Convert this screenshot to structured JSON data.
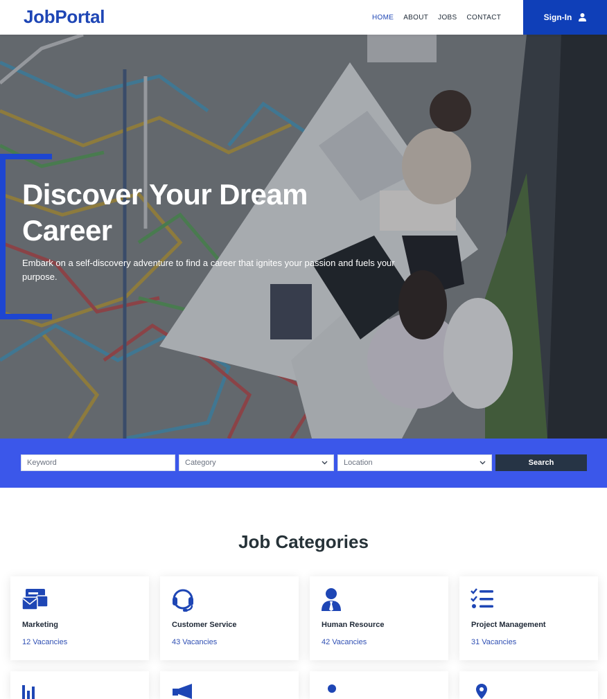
{
  "header": {
    "brand": "JobPortal",
    "nav": [
      {
        "label": "HOME",
        "active": true
      },
      {
        "label": "ABOUT",
        "active": false
      },
      {
        "label": "JOBS",
        "active": false
      },
      {
        "label": "CONTACT",
        "active": false
      }
    ],
    "signin_label": "Sign-In",
    "signin_icon": "user-icon"
  },
  "hero": {
    "title": "Discover Your Dream Career",
    "subtitle": "Embark on a self-discovery adventure to find a career that ignites your passion and fuels your purpose."
  },
  "search": {
    "keyword_placeholder": "Keyword",
    "category_value": "Category",
    "location_value": "Location",
    "button_label": "Search"
  },
  "categories": {
    "title": "Job Categories",
    "items": [
      {
        "name": "Marketing",
        "count": "12 Vacancies",
        "icon": "mail-cards-icon"
      },
      {
        "name": "Customer Service",
        "count": "43 Vacancies",
        "icon": "headset-icon"
      },
      {
        "name": "Human Resource",
        "count": "42 Vacancies",
        "icon": "user-tie-icon"
      },
      {
        "name": "Project Management",
        "count": "31 Vacancies",
        "icon": "list-check-icon"
      }
    ],
    "next_row_icons": [
      "chart-icon",
      "megaphone-icon",
      "person-icon",
      "map-pin-icon"
    ]
  },
  "colors": {
    "brand": "#1e46b5",
    "signin_bg": "#0f3fb8",
    "search_band": "#3b57ea",
    "search_button": "#263445",
    "accent_bracket": "#1e46d1"
  }
}
